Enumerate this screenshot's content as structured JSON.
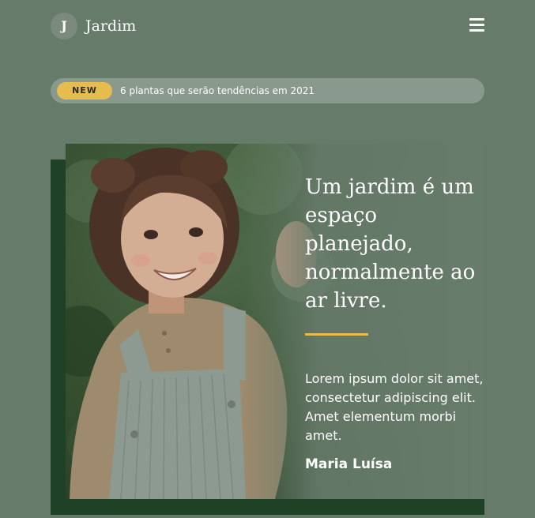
{
  "header": {
    "logo_letter": "J",
    "title": "Jardim",
    "menu_icon": "hamburger-menu-icon"
  },
  "news": {
    "badge": "NEW",
    "text": "6 plantas que serão tendências em 2021"
  },
  "hero": {
    "quote": "Um jardim é um espaço planejado, normalmente ao ar livre.",
    "body": "Lorem ipsum dolor sit amet, consectetur adipiscing elit. Amet elementum morbi amet.",
    "author": "Maria Luísa"
  },
  "colors": {
    "background": "#677b6b",
    "frame": "#1f4227",
    "accent": "#e6bc4f",
    "badge_pill": "#8a998d"
  }
}
